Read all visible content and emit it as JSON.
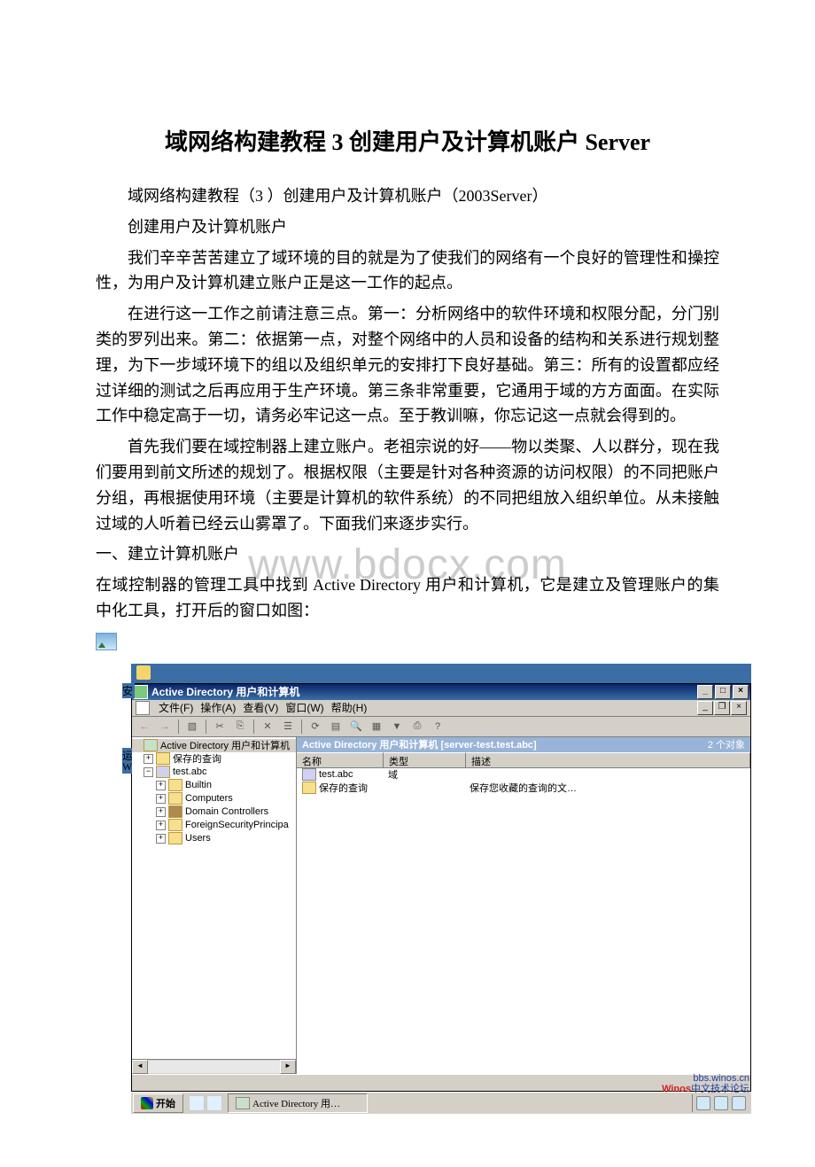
{
  "title": "域网络构建教程 3 创建用户及计算机账户 Server",
  "paragraphs": {
    "p1": "域网络构建教程（3 ）创建用户及计算机账户（2003Server）",
    "p2": "创建用户及计算机账户",
    "p3": "我们辛辛苦苦建立了域环境的目的就是为了使我们的网络有一个良好的管理性和操控性，为用户及计算机建立账户正是这一工作的起点。",
    "p4": "在进行这一工作之前请注意三点。第一：分析网络中的软件环境和权限分配，分门别类的罗列出来。第二：依据第一点，对整个网络中的人员和设备的结构和关系进行规划整理，为下一步域环境下的组以及组织单元的安排打下良好基础。第三：所有的设置都应经过详细的测试之后再应用于生产环境。第三条非常重要，它通用于域的方方面面。在实际工作中稳定高于一切，请务必牢记这一点。至于教训嘛，你忘记这一点就会得到的。",
    "p5": "首先我们要在域控制器上建立账户。老祖宗说的好——物以类聚、人以群分，现在我们要用到前文所述的规划了。根据权限（主要是针对各种资源的访问权限）的不同把账户分组，再根据使用环境（主要是计算机的软件系统）的不同把组放入组织单位。从未接触过域的人听着已经云山雾罩了。下面我们来逐步实行。",
    "p6": "一、建立计算机账户",
    "p7": "在域控制器的管理工具中找到 Active Directory 用户和计算机，它是建立及管理账户的集中化工具，打开后的窗口如图："
  },
  "watermark": "www.bdocx.com",
  "side_labels": {
    "a": "安",
    "b": "运",
    "c": "Wi"
  },
  "window": {
    "title": "Active Directory 用户和计算机",
    "menus": {
      "file": "文件(F)",
      "action": "操作(A)",
      "view": "查看(V)",
      "window": "窗口(W)",
      "help": "帮助(H)"
    },
    "tree": {
      "root": "Active Directory 用户和计算机",
      "saved_queries": "保存的查询",
      "domain": "test.abc",
      "nodes": {
        "builtin": "Builtin",
        "computers": "Computers",
        "dc": "Domain Controllers",
        "fsp": "ForeignSecurityPrincipa",
        "users": "Users"
      }
    },
    "list": {
      "header_title": "Active Directory 用户和计算机 [server-test.test.abc]",
      "object_count": "2 个对象",
      "columns": {
        "name": "名称",
        "type": "类型",
        "desc": "描述"
      },
      "rows": [
        {
          "name": "test.abc",
          "type": "域",
          "desc": ""
        },
        {
          "name": "保存的查询",
          "type": "",
          "desc": "保存您收藏的查询的文…"
        }
      ]
    }
  },
  "taskbar": {
    "start": "开始",
    "task_button": "Active Directory 用…"
  },
  "bbs": {
    "line1": "bbs.winos.cn",
    "line2_a": "Winos",
    "line2_b": "中文技术论坛"
  }
}
